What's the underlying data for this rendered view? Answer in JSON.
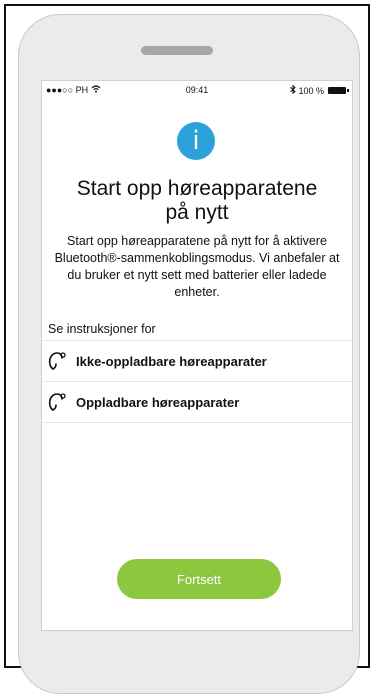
{
  "status_bar": {
    "carrier": "●●●○○ PH",
    "time": "09:41",
    "battery": "100 %"
  },
  "info_icon_glyph": "i",
  "title_line1": "Start opp høreapparatene",
  "title_line2": "på nytt",
  "description": "Start opp høreapparatene på nytt for å aktivere Bluetooth®-sammenkoblingsmodus. Vi anbefaler at du bruker et nytt sett med batterier eller ladede enheter.",
  "see_instructions": "Se instruksjoner for",
  "options": [
    {
      "label": "Ikke-oppladbare høreapparater",
      "icon": "hearing-aid-icon"
    },
    {
      "label": "Oppladbare høreapparater",
      "icon": "hearing-aid-icon"
    }
  ],
  "continue_label": "Fortsett",
  "colors": {
    "accent_blue": "#2aa1d8",
    "button_green": "#8dc63f"
  }
}
